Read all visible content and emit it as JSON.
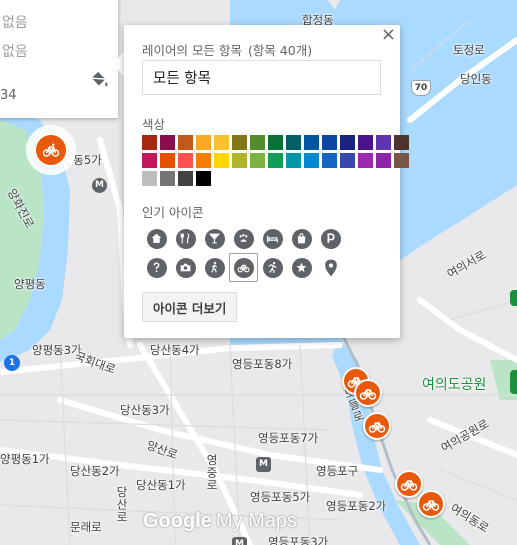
{
  "info_card": {
    "row1": "없음",
    "row2": "없음",
    "value": "34"
  },
  "popup": {
    "title": "레이어의 모든 항목",
    "count": "(항목 40개)",
    "close_label": "×",
    "name_value": "모든 항목",
    "color_label": "색상",
    "icon_label": "인기 아이콘",
    "more_icons_label": "아이콘 더보기",
    "selected_color": "#e8590c",
    "selected_icon": "bicycle-icon",
    "colors": [
      "#a52714",
      "#880e4f",
      "#c2591a",
      "#f9a825",
      "#fbc02d",
      "#817717",
      "#558b2f",
      "#097138",
      "#006064",
      "#01579b",
      "#0d47a1",
      "#1a237e",
      "#4a148c",
      "#5e35b1",
      "#4e342e",
      "#c2185b",
      "#e65100",
      "#ff5252",
      "#f57c00",
      "#ffd600",
      "#afb42b",
      "#7cb342",
      "#0f9d58",
      "#0097a7",
      "#0288d1",
      "#1565c0",
      "#3949ab",
      "#9c27b0",
      "#8e24aa",
      "#795548",
      "#bdbdbd",
      "#757575",
      "#424242",
      "#000000"
    ],
    "icons": [
      "home",
      "restaurant",
      "bar",
      "pet",
      "hotel",
      "shopping",
      "parking",
      "help",
      "camera",
      "walk",
      "bicycle",
      "run",
      "star",
      "pin"
    ]
  },
  "map": {
    "labels": {
      "hapjeong": "합정동",
      "tojeong": "토정로",
      "dangin": "당인동",
      "dong5": ", 동5가",
      "yanghwa": "양화진로",
      "yangpyeong": "양평동",
      "yeouiseo": "여의서로",
      "yangpyeong3": "양평동3가",
      "gukhoe": "국회대로",
      "dangsan4": "당산동4가",
      "yeongdeungpo8": "영등포동8가",
      "dangsan3": "당산동3가",
      "yeouido_park": "여의도공원",
      "yeouigongwon": "여의공원로",
      "yeongdeungpo7": "영등포동7가",
      "yangsan": "양산로",
      "yangpyeong1": "양평동1가",
      "dangsan2": "당산동2가",
      "dangsan1": "당산동1가",
      "yeongdeungpo_gu": "영등포구",
      "yeongdeungpo5": "영등포동5가",
      "yeongdeungpo2": "영등포동2가",
      "yeouidong": "여의동로",
      "munrae": "문래로",
      "dangsanro": "당산로",
      "yeongdeungpo3": "영등포동3가",
      "noeul": "노들로",
      "yeongjung": "영중로"
    },
    "badges": {
      "road_70": "70",
      "line_1": "1",
      "metro": "M"
    }
  },
  "logo": {
    "google": "Google",
    "maps": "My Maps"
  }
}
